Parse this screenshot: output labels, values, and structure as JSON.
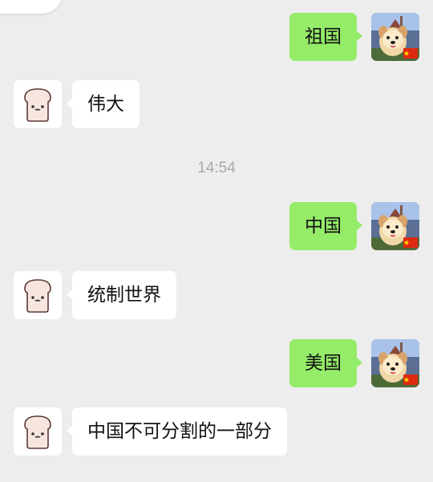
{
  "messages": [
    {
      "sender": "me",
      "text": "祖国"
    },
    {
      "sender": "other",
      "text": "伟大"
    },
    {
      "sender": "me",
      "text": "中国"
    },
    {
      "sender": "other",
      "text": "统制世界"
    },
    {
      "sender": "me",
      "text": "美国"
    },
    {
      "sender": "other",
      "text": "中国不可分割的一部分"
    }
  ],
  "timestamp": "14:54",
  "avatars": {
    "me": "dog-photo-avatar-with-flag-icon",
    "other": "toast-avatar-icon"
  },
  "colors": {
    "background": "#ededed",
    "my_bubble": "#95ec69",
    "their_bubble": "#ffffff",
    "timestamp_text": "#a9a9a9"
  }
}
